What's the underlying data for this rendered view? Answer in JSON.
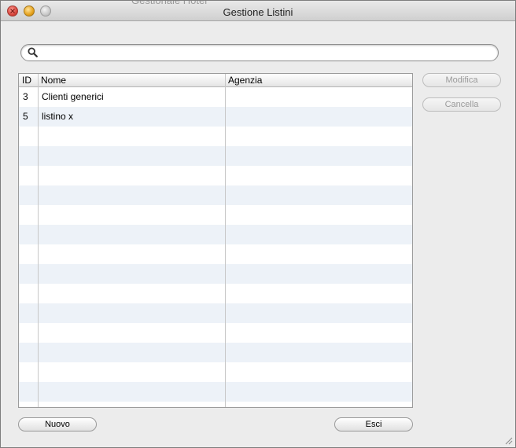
{
  "background_window": {
    "title": "Gestionale Hotel"
  },
  "window": {
    "title": "Gestione Listini"
  },
  "search": {
    "value": "",
    "placeholder": ""
  },
  "table": {
    "columns": [
      "ID",
      "Nome",
      "Agenzia"
    ],
    "rows": [
      {
        "id": "3",
        "nome": "Clienti generici",
        "agenzia": ""
      },
      {
        "id": "5",
        "nome": "listino x",
        "agenzia": ""
      }
    ]
  },
  "buttons": {
    "modify": "Modifica",
    "delete": "Cancella",
    "new": "Nuovo",
    "exit": "Esci"
  },
  "colors": {
    "row_alt": "#edf2f8",
    "window_bg": "#ececec"
  }
}
